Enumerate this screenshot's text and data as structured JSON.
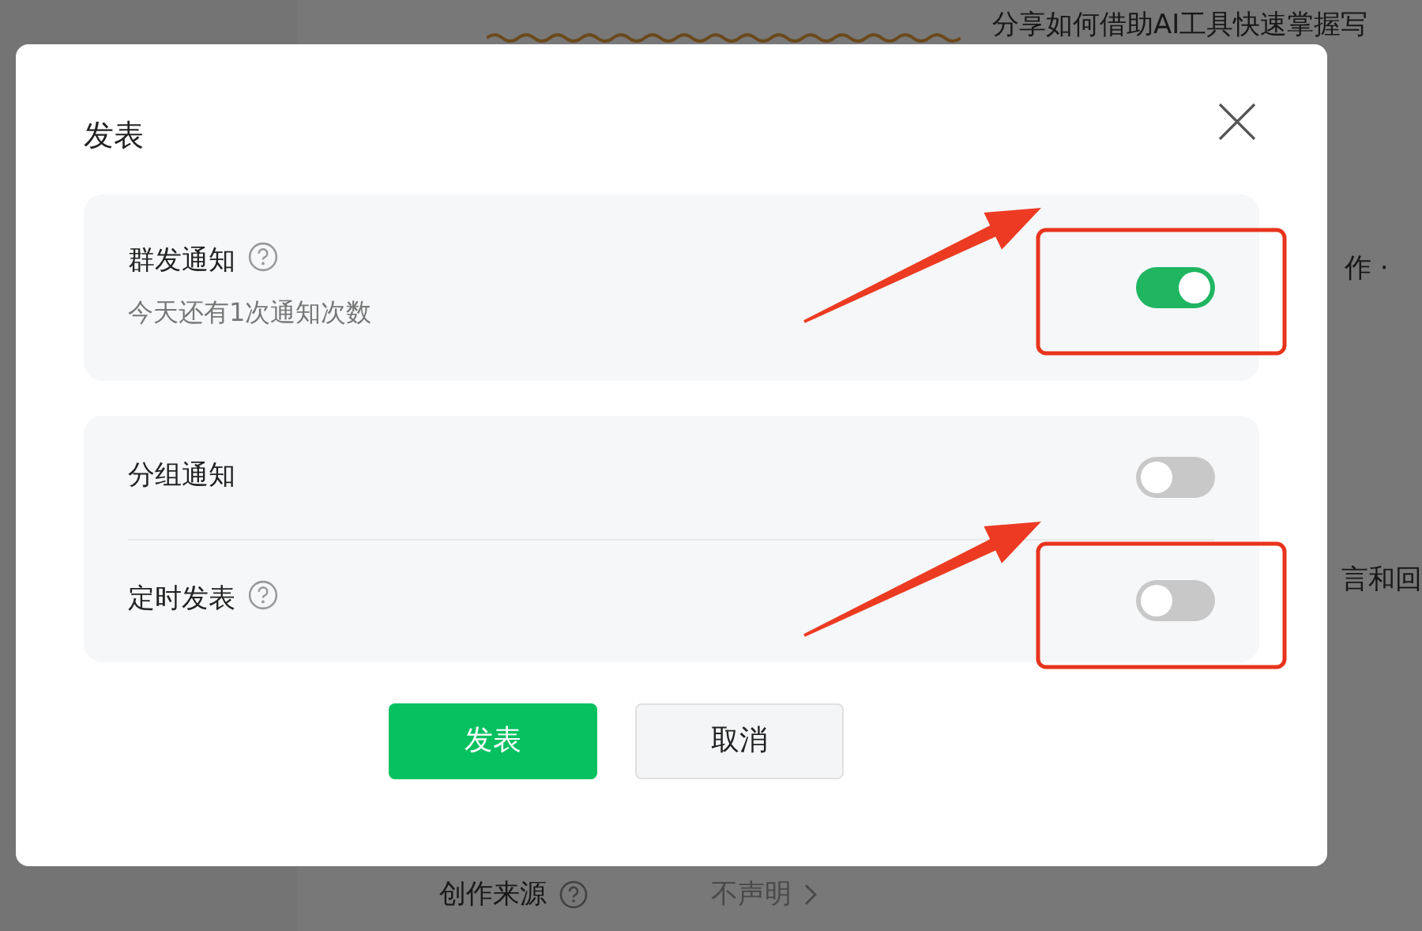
{
  "background": {
    "summary": "分享如何借助AI工具快速掌握写",
    "fragment_1": "作 ·",
    "fragment_2": "言和回",
    "source_label": "创作来源",
    "source_value": "不声明"
  },
  "dialog": {
    "title": "发表",
    "sections": [
      {
        "items": [
          {
            "label": "群发通知",
            "help": true,
            "note": "今天还有1次通知次数",
            "on": true,
            "highlighted": true
          }
        ]
      },
      {
        "items": [
          {
            "label": "分组通知",
            "help": false,
            "on": false,
            "highlighted": false
          },
          {
            "label": "定时发表",
            "help": true,
            "on": false,
            "highlighted": true
          }
        ]
      }
    ],
    "buttons": [
      {
        "label": "发表",
        "kind": "primary"
      },
      {
        "label": "取消",
        "kind": "secondary"
      }
    ]
  }
}
